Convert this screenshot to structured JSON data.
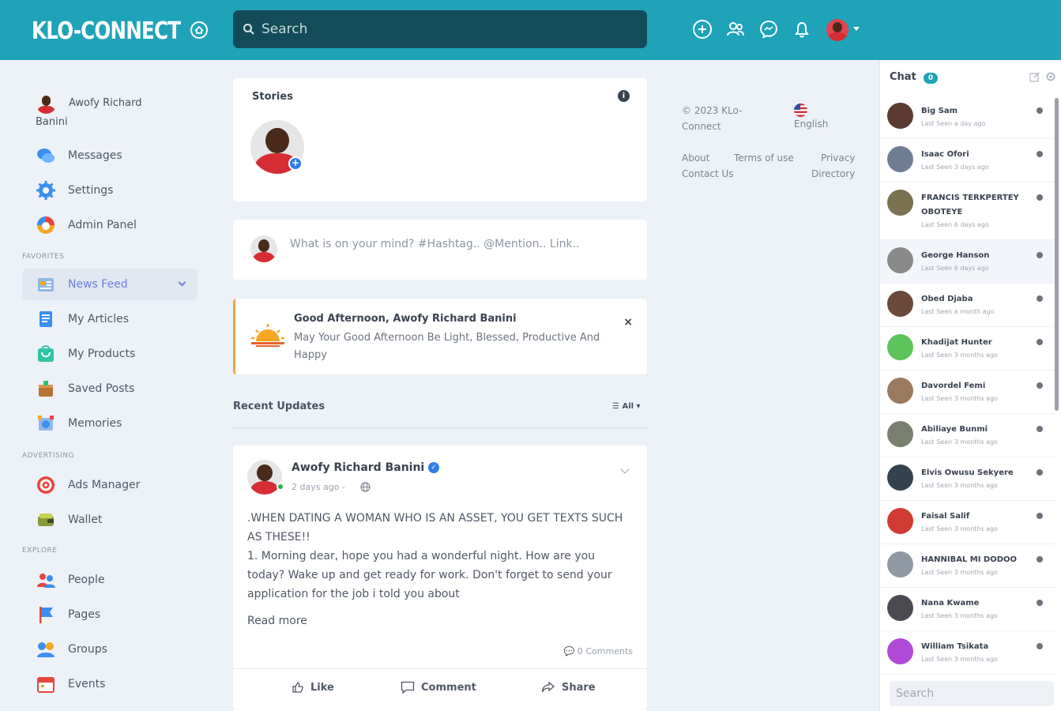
{
  "header": {
    "logo_text": "KLO-CONNECT",
    "search_placeholder": "Search",
    "icons": [
      "add-circle-icon",
      "friends-icon",
      "messenger-icon",
      "bell-icon"
    ],
    "accent": "#1ea3b8",
    "search_bg": "#144b58"
  },
  "sidebar": {
    "profile_name": "Awofy Richard Banini",
    "top_items": [
      {
        "label": "Messages",
        "icon": "messages-icon"
      },
      {
        "label": "Settings",
        "icon": "settings-icon"
      },
      {
        "label": "Admin Panel",
        "icon": "admin-panel-icon"
      }
    ],
    "section_favorites": "FAVORITES",
    "favorites": [
      {
        "label": "News Feed",
        "icon": "news-feed-icon",
        "active": true
      },
      {
        "label": "My Articles",
        "icon": "articles-icon"
      },
      {
        "label": "My Products",
        "icon": "products-icon"
      },
      {
        "label": "Saved Posts",
        "icon": "saved-posts-icon"
      },
      {
        "label": "Memories",
        "icon": "memories-icon"
      }
    ],
    "section_advertising": "ADVERTISING",
    "advertising": [
      {
        "label": "Ads Manager",
        "icon": "ads-manager-icon"
      },
      {
        "label": "Wallet",
        "icon": "wallet-icon"
      }
    ],
    "section_explore": "EXPLORE",
    "explore": [
      {
        "label": "People",
        "icon": "people-icon"
      },
      {
        "label": "Pages",
        "icon": "pages-icon"
      },
      {
        "label": "Groups",
        "icon": "groups-icon"
      },
      {
        "label": "Events",
        "icon": "events-icon"
      }
    ]
  },
  "stories": {
    "title": "Stories"
  },
  "composer": {
    "placeholder": "What is on your mind? #Hashtag.. @Mention.. Link.."
  },
  "greeting": {
    "title": "Good Afternoon, Awofy Richard Banini",
    "message": "May Your Good Afternoon Be Light, Blessed, Productive And Happy",
    "close": "×"
  },
  "recent": {
    "title": "Recent Updates",
    "filter": "All"
  },
  "post": {
    "author": "Awofy Richard Banini",
    "time": "2 days ago -",
    "body_line1": ".WHEN DATING A WOMAN WHO IS AN ASSET, YOU GET TEXTS SUCH AS THESE!!",
    "body_line2": "1. Morning dear, hope you had a wonderful night. How are you today? Wake up and get ready for work. Don't forget to send your application for the job i told you about",
    "read_more": "Read more",
    "comments": "0 Comments",
    "actions": {
      "like": "Like",
      "comment": "Comment",
      "share": "Share"
    }
  },
  "footer": {
    "copyright": "© 2023 KLo-Connect",
    "language": "English",
    "links": {
      "about": "About",
      "terms": "Terms of use",
      "privacy": "Privacy",
      "contact": "Contact Us",
      "directory": "Directory"
    }
  },
  "chat": {
    "title": "Chat",
    "badge": "0",
    "search_placeholder": "Search",
    "contacts": [
      {
        "name": "Big Sam",
        "seen": "Last Seen a day ago",
        "color": "#5a3a30"
      },
      {
        "name": "Isaac Ofori",
        "seen": "Last Seen 3 days ago",
        "color": "#6f7d94"
      },
      {
        "name": "FRANCIS TERKPERTEY OBOTEYE",
        "seen": "Last Seen 6 days ago",
        "color": "#7a7250"
      },
      {
        "name": "George Hanson",
        "seen": "Last Seen 6 days ago",
        "color": "#8a8a8a"
      },
      {
        "name": "Obed Djaba",
        "seen": "Last Seen a month ago",
        "color": "#6b4a3a"
      },
      {
        "name": "Khadijat Hunter",
        "seen": "Last Seen 3 months ago",
        "color": "#5cc45a"
      },
      {
        "name": "Davordel Femi",
        "seen": "Last Seen 3 months ago",
        "color": "#9a7a60"
      },
      {
        "name": "Abiliaye Bunmi",
        "seen": "Last Seen 3 months ago",
        "color": "#7a8070"
      },
      {
        "name": "Elvis Owusu Sekyere",
        "seen": "Last Seen 3 months ago",
        "color": "#34414f"
      },
      {
        "name": "Faisal Salif",
        "seen": "Last Seen 3 months ago",
        "color": "#d23a34"
      },
      {
        "name": "HANNIBAL MI DODOO",
        "seen": "Last Seen 3 months ago",
        "color": "#9098a4"
      },
      {
        "name": "Nana Kwame",
        "seen": "Last Seen 3 months ago",
        "color": "#4a4a50"
      },
      {
        "name": "William Tsikata",
        "seen": "Last Seen 3 months ago",
        "color": "#b04ad6"
      }
    ]
  }
}
